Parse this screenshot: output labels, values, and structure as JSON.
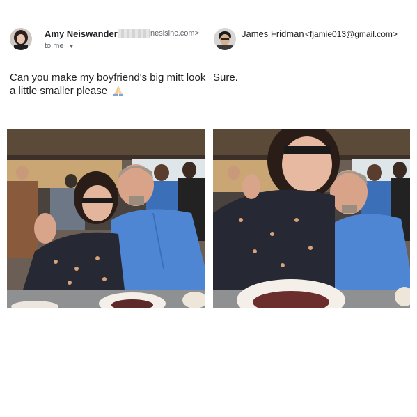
{
  "left_email": {
    "sender_name": "Amy Neiswander",
    "sender_email": "nesisinc.com>",
    "recipient_label": "to me",
    "message": "Can you make my boyfriend's big mitt look a little smaller please",
    "emoji": "pray-hands",
    "photo_label": "Original photo: couple at restaurant table"
  },
  "right_email": {
    "sender_name": "James Fridman",
    "sender_email": "<fjamie013@gmail.com>",
    "message": "Sure.",
    "photo_label": "Edited photo: couple at restaurant table"
  }
}
